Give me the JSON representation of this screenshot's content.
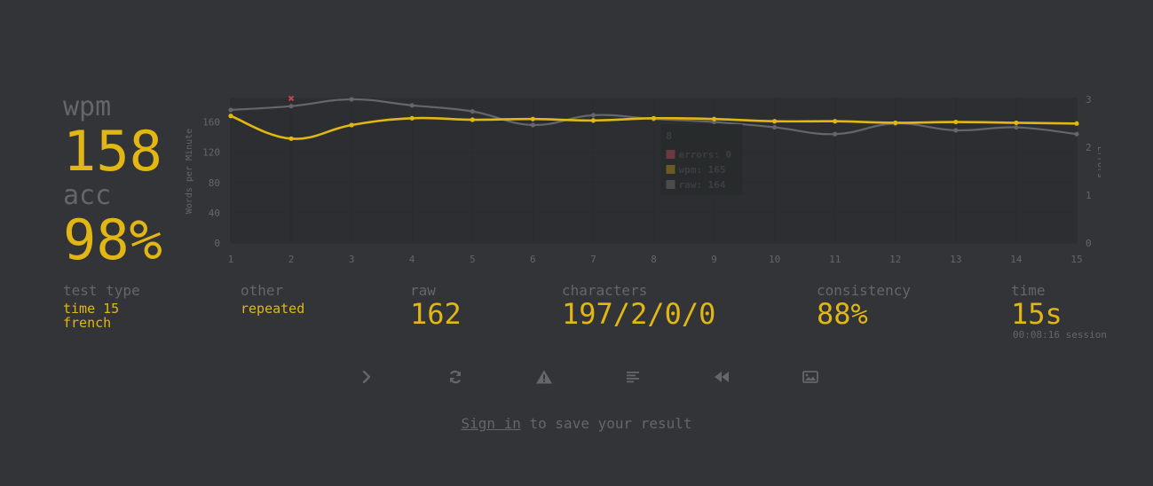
{
  "result": {
    "wpm_label": "wpm",
    "wpm_value": "158",
    "acc_label": "acc",
    "acc_value": "98%"
  },
  "stats": {
    "test_type": {
      "label": "test type",
      "line1": "time 15",
      "line2": "french"
    },
    "other": {
      "label": "other",
      "value": "repeated"
    },
    "raw": {
      "label": "raw",
      "value": "162"
    },
    "characters": {
      "label": "characters",
      "value": "197/2/0/0"
    },
    "consistency": {
      "label": "consistency",
      "value": "88%"
    },
    "time": {
      "label": "time",
      "value": "15s",
      "session": "00:08:16 session"
    }
  },
  "buttons": [
    {
      "name": "next-test-button",
      "icon": "chevron-right-icon"
    },
    {
      "name": "restart-test-button",
      "icon": "refresh-icon"
    },
    {
      "name": "toggle-words-history-button",
      "icon": "warning-icon"
    },
    {
      "name": "words-history-button",
      "icon": "align-left-icon"
    },
    {
      "name": "watch-replay-button",
      "icon": "backward-icon"
    },
    {
      "name": "save-screenshot-button",
      "icon": "image-icon"
    }
  ],
  "footer": {
    "signin_link": "Sign in",
    "signin_rest": " to save your result"
  },
  "colors": {
    "background": "#323437",
    "accent": "#e2b714",
    "sub": "#646669",
    "error": "#ca4754"
  },
  "chart_data": {
    "type": "line",
    "x": [
      1,
      2,
      3,
      4,
      5,
      6,
      7,
      8,
      9,
      10,
      11,
      12,
      13,
      14,
      15
    ],
    "series": [
      {
        "name": "wpm",
        "color": "#e2b714",
        "values": [
          168,
          138,
          156,
          165,
          163,
          164,
          162,
          165,
          164,
          161,
          161,
          159,
          160,
          159,
          158
        ]
      },
      {
        "name": "raw",
        "color": "#646669",
        "values": [
          176,
          181,
          190,
          182,
          174,
          156,
          169,
          164,
          160,
          153,
          144,
          158,
          149,
          153,
          144
        ]
      },
      {
        "name": "errors",
        "color": "#ca4754",
        "values": [
          0,
          3,
          0,
          0,
          0,
          0,
          0,
          0,
          0,
          0,
          0,
          0,
          0,
          0,
          0
        ]
      }
    ],
    "ylabel": "Words per Minute",
    "y2label": "Errors",
    "yticks": [
      0,
      40,
      80,
      120,
      160
    ],
    "y2ticks": [
      0,
      1,
      2,
      3
    ],
    "ylim": [
      0,
      190
    ],
    "y2lim": [
      0,
      3
    ],
    "xlim": [
      1,
      15
    ],
    "tooltip": {
      "title": "8",
      "lines": [
        "errors: 0",
        "wpm: 165",
        "raw: 164"
      ]
    }
  }
}
